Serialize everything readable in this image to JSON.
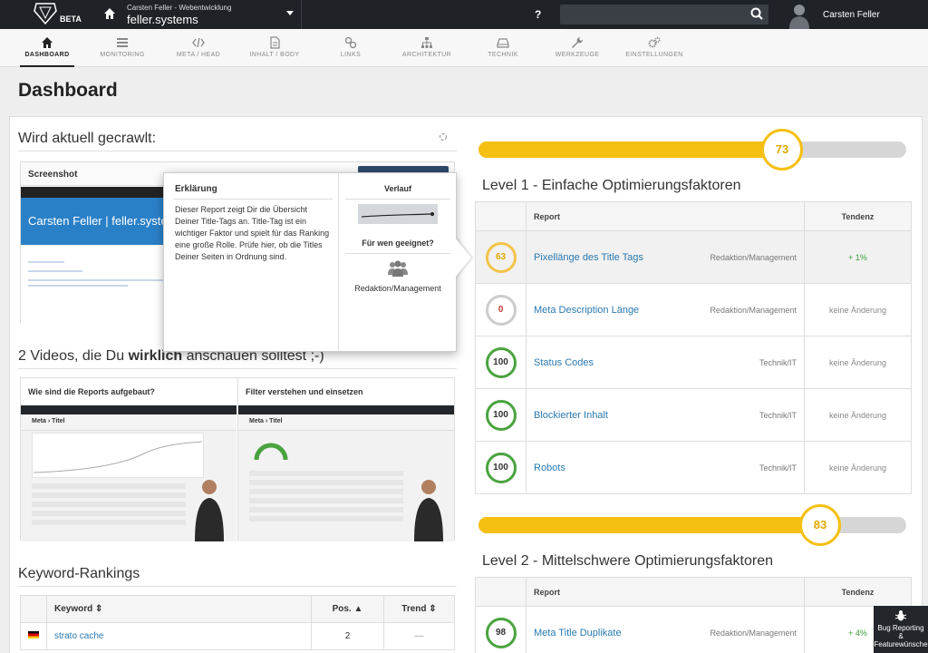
{
  "header": {
    "beta": "BETA",
    "project_owner": "Carsten Feller - Webentwicklung",
    "project_name": "feller.systems",
    "help": "?",
    "search_placeholder": "",
    "user_name": "Carsten Feller"
  },
  "nav": [
    {
      "label": "DASHBOARD",
      "icon": "home-icon"
    },
    {
      "label": "MONITORING",
      "icon": "list-icon"
    },
    {
      "label": "META / HEAD",
      "icon": "code-icon"
    },
    {
      "label": "INHALT / BODY",
      "icon": "document-icon"
    },
    {
      "label": "LINKS",
      "icon": "link-icon"
    },
    {
      "label": "ARCHITEKTUR",
      "icon": "sitemap-icon"
    },
    {
      "label": "TECHNIK",
      "icon": "drive-icon"
    },
    {
      "label": "WERKZEUGE",
      "icon": "wrench-icon"
    },
    {
      "label": "EINSTELLUNGEN",
      "icon": "gears-icon"
    }
  ],
  "page_title": "Dashboard",
  "crawl": {
    "title": "Wird aktuell gecrawlt:",
    "screenshot_label": "Screenshot",
    "screenshot_site_title": "Carsten Feller | feller.systems"
  },
  "videos": {
    "title_pre": "2 Videos, die Du ",
    "title_bold": "wirklich",
    "title_post": " anschauen solltest ;-)",
    "items": [
      {
        "label": "Wie sind die Reports aufgebaut?",
        "thumb_title": "Meta › Titel"
      },
      {
        "label": "Filter verstehen und einsetzen",
        "thumb_title": "Meta › Titel"
      }
    ]
  },
  "keywords": {
    "title": "Keyword-Rankings",
    "columns": [
      "Keyword",
      "Pos.",
      "Trend"
    ],
    "rows": [
      {
        "keyword": "strato cache",
        "pos": "2",
        "trend": "—"
      }
    ]
  },
  "tooltip": {
    "title": "Erklärung",
    "text": "Dieser Report zeigt Dir die Übersicht Deiner Title-Tags an. Title-Tag ist ein wichtiger Faktor und spielt für das Ranking eine große Rolle. Prüfe hier, ob die Titles Deiner Seiten in Ordnung sind.",
    "verlauf": "Verlauf",
    "fuer_wen": "Für wen geeignet?",
    "audience": "Redaktion/Management"
  },
  "level1": {
    "score": "73",
    "progress_percent": 73,
    "title": "Level 1 - Einfache Optimierungsfaktoren",
    "col_report": "Report",
    "col_tendenz": "Tendenz",
    "rows": [
      {
        "score": "63",
        "name": "Pixellänge des Title Tags",
        "audience": "Redaktion/Management",
        "trend": "+ 1%"
      },
      {
        "score": "0",
        "name": "Meta Description Länge",
        "audience": "Redaktion/Management",
        "trend": "keine Änderung"
      },
      {
        "score": "100",
        "name": "Status Codes",
        "audience": "Technik/IT",
        "trend": "keine Änderung"
      },
      {
        "score": "100",
        "name": "Blockierter Inhalt",
        "audience": "Technik/IT",
        "trend": "keine Änderung"
      },
      {
        "score": "100",
        "name": "Robots",
        "audience": "Technik/IT",
        "trend": "keine Änderung"
      }
    ]
  },
  "level2": {
    "score": "83",
    "progress_percent": 83,
    "title": "Level 2 - Mittelschwere Optimierungsfaktoren",
    "col_report": "Report",
    "col_tendenz": "Tendenz",
    "rows": [
      {
        "score": "98",
        "name": "Meta Title Duplikate",
        "audience": "Redaktion/Management",
        "trend": "+ 4%"
      }
    ]
  },
  "bug_button": {
    "line1": "Bug Reporting",
    "line2": "& Featurewünsche"
  },
  "colors": {
    "accent": "#f5c012",
    "topbar": "#1f2328",
    "good": "#4aa33f",
    "link": "#2a7ab0"
  }
}
